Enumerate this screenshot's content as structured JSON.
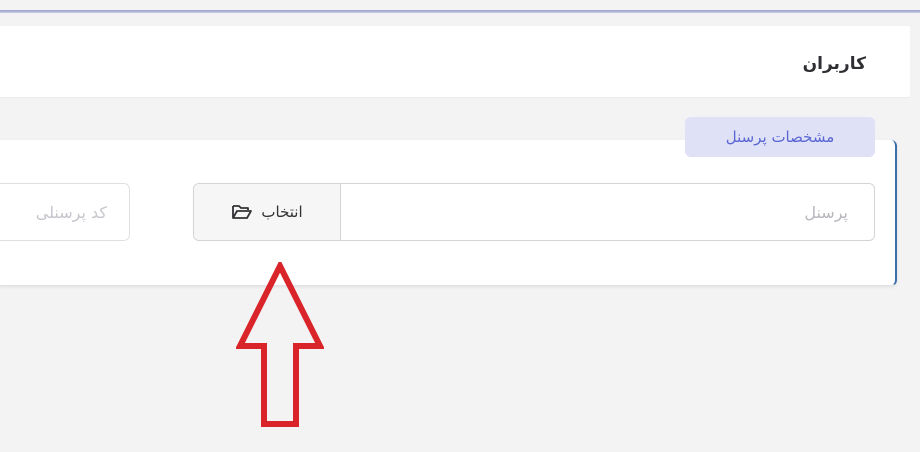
{
  "page": {
    "title": "کاربران"
  },
  "personnel_section": {
    "legend": "مشخصات پرسنل",
    "personnel_placeholder": "پرسنل",
    "select_label": "انتخاب",
    "code_label": "کد پرسنلی"
  },
  "icons": {
    "select_icon": "folder-open-icon",
    "annotation": "up-arrow-icon"
  },
  "colors": {
    "arrow": "#d9242a",
    "legend_bg": "#dfe1f7",
    "legend_text": "#5a66d2",
    "panel_accent": "#3f6fa8"
  }
}
